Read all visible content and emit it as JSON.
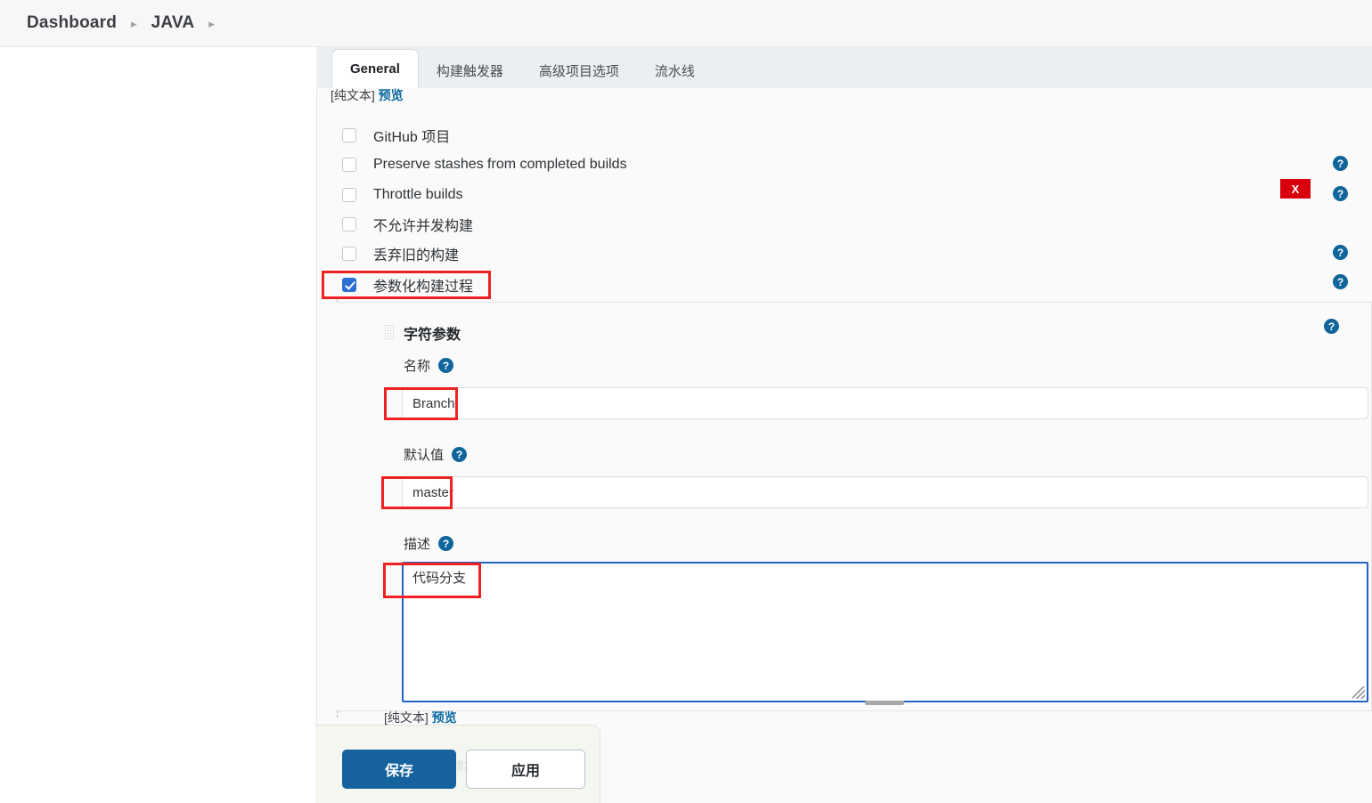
{
  "breadcrumb": {
    "items": [
      "Dashboard",
      "JAVA"
    ],
    "separator": "▸"
  },
  "tabs": [
    {
      "label": "General",
      "active": true
    },
    {
      "label": "构建触发器",
      "active": false
    },
    {
      "label": "高级项目选项",
      "active": false
    },
    {
      "label": "流水线",
      "active": false
    }
  ],
  "top_markup": {
    "plain_text": "[纯文本]",
    "preview_link": "预览"
  },
  "checkboxes": [
    {
      "label": "GitHub 项目",
      "checked": false,
      "help": false
    },
    {
      "label": "Preserve stashes from completed builds",
      "checked": false,
      "help": true
    },
    {
      "label": "Throttle builds",
      "checked": false,
      "help": true
    },
    {
      "label": "不允许并发构建",
      "checked": false,
      "help": false
    },
    {
      "label": "丢弃旧的构建",
      "checked": false,
      "help": true
    },
    {
      "label": "参数化构建过程",
      "checked": true,
      "help": true
    }
  ],
  "parameter": {
    "title": "字符参数",
    "delete_label": "X",
    "name_label": "名称",
    "name_value": "Branch",
    "default_label": "默认值",
    "default_value": "master",
    "description_label": "描述",
    "description_value": "代码分支",
    "markup": {
      "plain_text": "[纯文本]",
      "preview_link": "预览"
    }
  },
  "help_icon_glyph": "?",
  "actions": {
    "save": "保存",
    "apply": "应用",
    "ghost": "增加参数"
  },
  "colors": {
    "accent_blue": "#16629c",
    "checkbox_blue": "#2b6fd4",
    "help_blue": "#10659b",
    "delete_red": "#d9000d",
    "annotation_red": "#ee2222",
    "focus_blue": "#1f64c4",
    "link_blue": "#0b6aa2"
  }
}
